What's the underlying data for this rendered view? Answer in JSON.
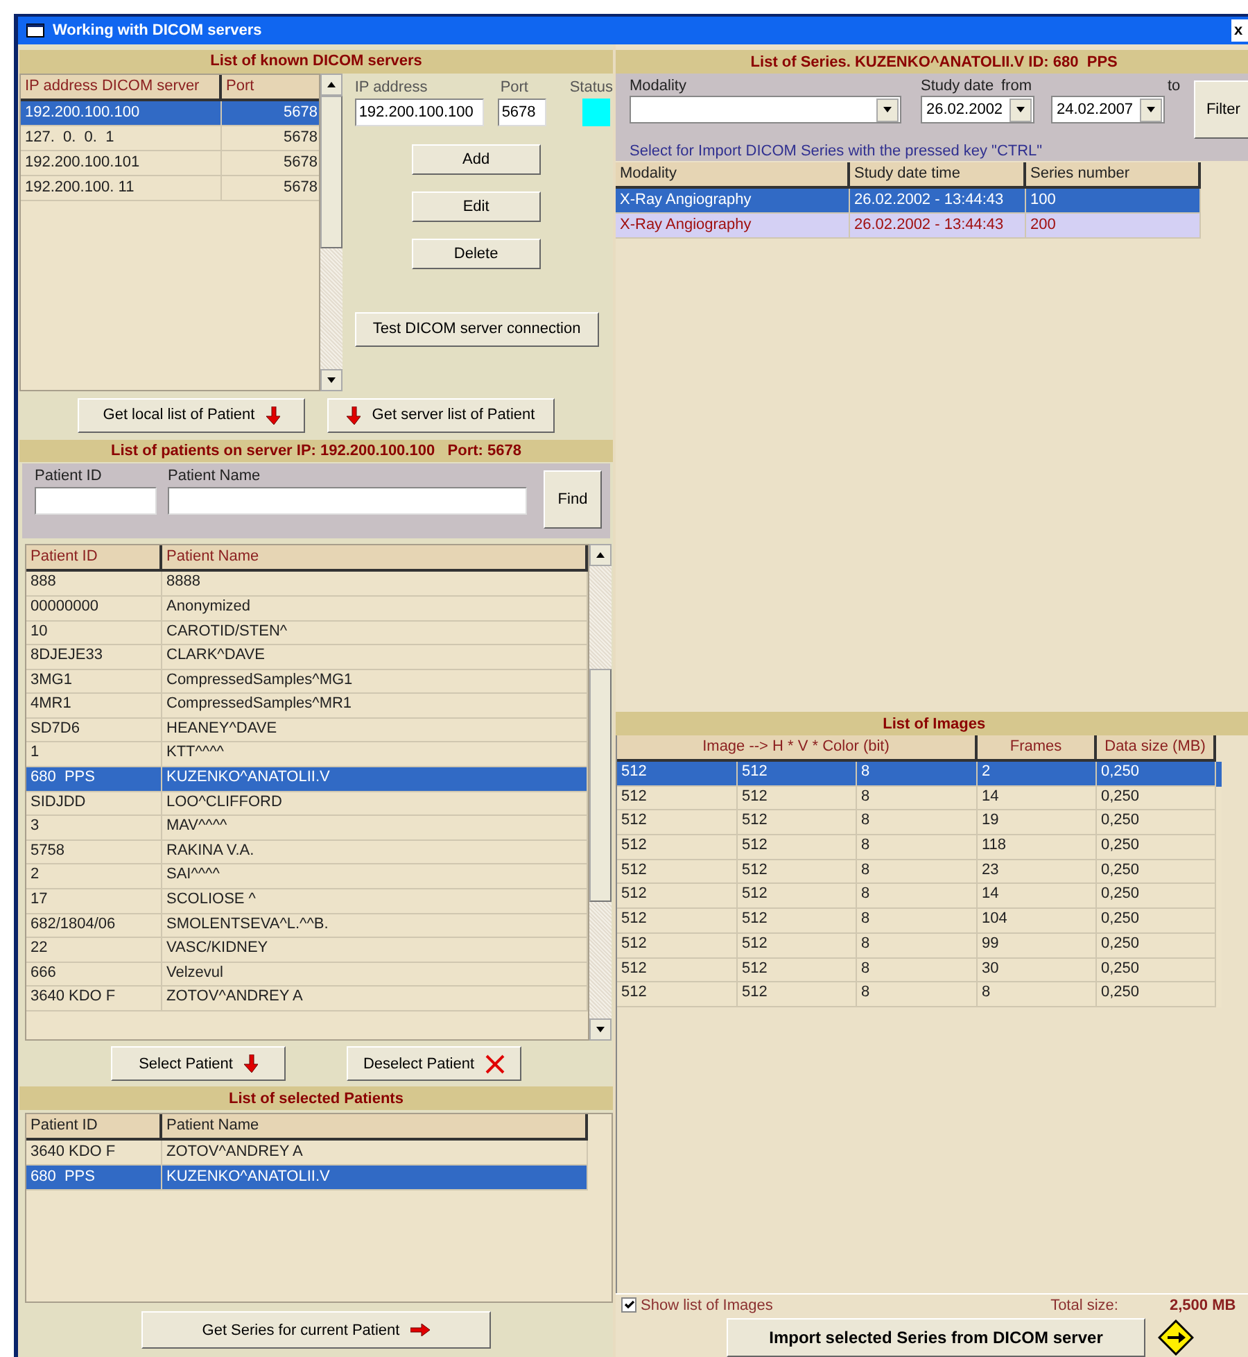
{
  "window": {
    "title": "Working with DICOM servers",
    "close": "x"
  },
  "servers": {
    "title": "List of known DICOM servers",
    "columns": [
      "IP address DICOM server",
      "Port"
    ],
    "rows": [
      {
        "ip": "192.200.100.100",
        "port": "5678",
        "selected": true
      },
      {
        "ip": "127.  0.  0.  1",
        "port": "5678",
        "selected": false
      },
      {
        "ip": "192.200.100.101",
        "port": "5678",
        "selected": false
      },
      {
        "ip": "192.200.100. 11",
        "port": "5678",
        "selected": false
      }
    ],
    "ip_label": "IP address",
    "ip_value": "192.200.100.100",
    "port_label": "Port",
    "port_value": "5678",
    "status_label": "Status",
    "buttons": [
      "Add",
      "Edit",
      "Delete"
    ],
    "test_button": "Test DICOM server connection"
  },
  "fetch_buttons": [
    {
      "label": "Get local list of Patient",
      "kind": "arrow-after"
    },
    {
      "label": "Get server list of Patient",
      "kind": "arrow-before"
    }
  ],
  "patients": {
    "title": "List of patients on server IP: 192.200.100.100   Port: 5678",
    "id_label": "Patient ID",
    "name_label": "Patient Name",
    "find_button": "Find",
    "columns": [
      "Patient ID",
      "Patient Name"
    ],
    "rows": [
      {
        "id": "888",
        "name": "8888",
        "selected": false
      },
      {
        "id": "00000000",
        "name": "Anonymized",
        "selected": false
      },
      {
        "id": "10",
        "name": "CAROTID/STEN^",
        "selected": false
      },
      {
        "id": "8DJEJE33",
        "name": "CLARK^DAVE",
        "selected": false
      },
      {
        "id": "3MG1",
        "name": "CompressedSamples^MG1",
        "selected": false
      },
      {
        "id": "4MR1",
        "name": "CompressedSamples^MR1",
        "selected": false
      },
      {
        "id": "SD7D6",
        "name": "HEANEY^DAVE",
        "selected": false
      },
      {
        "id": "1",
        "name": "KTT^^^^",
        "selected": false
      },
      {
        "id": "680  PPS",
        "name": "KUZENKO^ANATOLII.V",
        "selected": true
      },
      {
        "id": "SIDJDD",
        "name": "LOO^CLIFFORD",
        "selected": false
      },
      {
        "id": "3",
        "name": "MAV^^^^",
        "selected": false
      },
      {
        "id": "5758",
        "name": "RAKINA V.A.",
        "selected": false
      },
      {
        "id": "2",
        "name": "SAI^^^^",
        "selected": false
      },
      {
        "id": "17",
        "name": "SCOLIOSE ^",
        "selected": false
      },
      {
        "id": "682/1804/06",
        "name": "SMOLENTSEVA^L.^^B.",
        "selected": false
      },
      {
        "id": "22",
        "name": "VASC/KIDNEY",
        "selected": false
      },
      {
        "id": "666",
        "name": "Velzevul",
        "selected": false
      },
      {
        "id": "3640 KDO F",
        "name": "ZOTOV^ANDREY A",
        "selected": false
      }
    ]
  },
  "select_buttons": [
    {
      "label": "Select Patient",
      "kind": "arrow"
    },
    {
      "label": "Deselect Patient",
      "kind": "cross"
    }
  ],
  "selected_patients": {
    "title": "List of selected Patients",
    "columns": [
      "Patient ID",
      "Patient Name"
    ],
    "rows": [
      {
        "id": "3640 KDO F",
        "name": "ZOTOV^ANDREY A",
        "selected": false
      },
      {
        "id": "680  PPS",
        "name": "KUZENKO^ANATOLII.V",
        "selected": true
      }
    ]
  },
  "get_series_button": "Get Series for current Patient",
  "series": {
    "title": "List of Series. KUZENKO^ANATOLII.V ID: 680  PPS",
    "modality_label": "Modality",
    "date_label": "Study date",
    "from_label": "from",
    "to_label": "to",
    "date_from": "26.02.2002",
    "date_to": "24.02.2007",
    "filter_button": "Filter",
    "hint": "Select for Import DICOM Series with the pressed key \"CTRL\"",
    "columns": [
      "Modality",
      "Study date time",
      "Series number"
    ],
    "rows": [
      {
        "modality": "X-Ray Angiography",
        "datetime": "26.02.2002 - 13:44:43",
        "number": "100",
        "selected": true
      },
      {
        "modality": "X-Ray Angiography",
        "datetime": "26.02.2002 - 13:44:43",
        "number": "200",
        "selected": false
      }
    ]
  },
  "images": {
    "title": "List of Images",
    "dimensions_header": "Image --> H * V * Color (bit)",
    "frames_header": "Frames",
    "size_header": "Data size (MB)",
    "rows": [
      {
        "cells": [
          "512",
          "512",
          "8",
          "2",
          "0,250"
        ],
        "selected": true
      },
      {
        "cells": [
          "512",
          "512",
          "8",
          "14",
          "0,250"
        ],
        "selected": false
      },
      {
        "cells": [
          "512",
          "512",
          "8",
          "19",
          "0,250"
        ],
        "selected": false
      },
      {
        "cells": [
          "512",
          "512",
          "8",
          "118",
          "0,250"
        ],
        "selected": false
      },
      {
        "cells": [
          "512",
          "512",
          "8",
          "23",
          "0,250"
        ],
        "selected": false
      },
      {
        "cells": [
          "512",
          "512",
          "8",
          "14",
          "0,250"
        ],
        "selected": false
      },
      {
        "cells": [
          "512",
          "512",
          "8",
          "104",
          "0,250"
        ],
        "selected": false
      },
      {
        "cells": [
          "512",
          "512",
          "8",
          "99",
          "0,250"
        ],
        "selected": false
      },
      {
        "cells": [
          "512",
          "512",
          "8",
          "30",
          "0,250"
        ],
        "selected": false
      },
      {
        "cells": [
          "512",
          "512",
          "8",
          "8",
          "0,250"
        ],
        "selected": false
      }
    ]
  },
  "footer": {
    "show_images_label": "Show list of Images",
    "show_images_checked": true,
    "total_label": "Total size:",
    "total_value": "2,500 MB",
    "import_button": "Import selected Series from DICOM server"
  }
}
